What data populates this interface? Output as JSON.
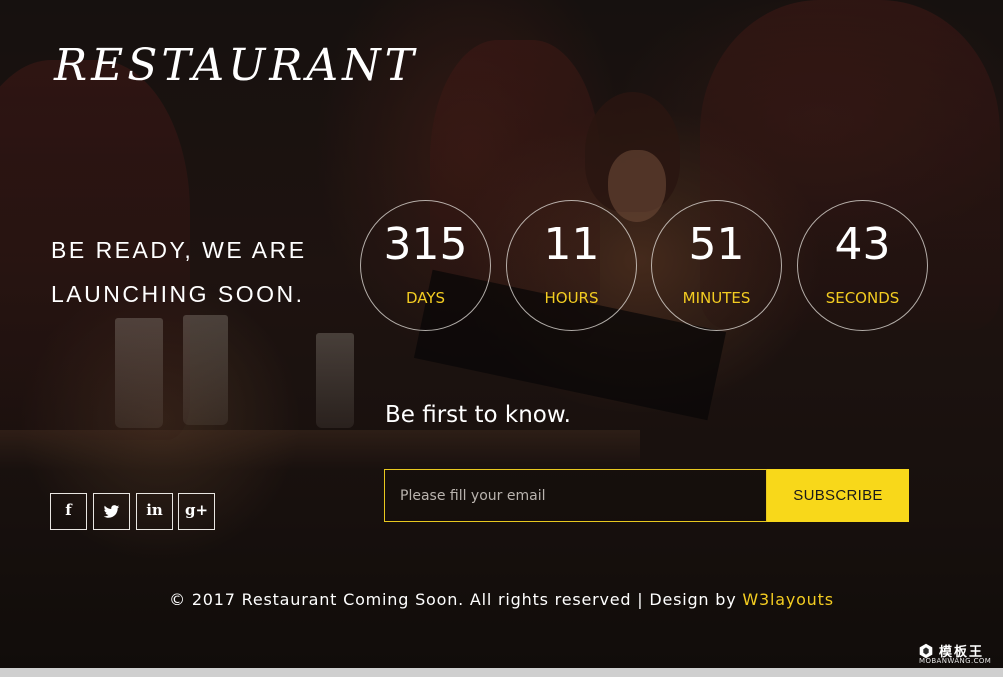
{
  "brand": {
    "logo_text": "RESTAURANT"
  },
  "tagline": {
    "line1": "BE READY, WE ARE",
    "line2": "LAUNCHING SOON."
  },
  "countdown": [
    {
      "value": "315",
      "unit": "DAYS"
    },
    {
      "value": "11",
      "unit": "HOURS"
    },
    {
      "value": "51",
      "unit": "MINUTES"
    },
    {
      "value": "43",
      "unit": "SECONDS"
    }
  ],
  "subscribe": {
    "title": "Be first to know.",
    "email_placeholder": "Please fill your email",
    "email_value": "",
    "button_label": "SUBSCRIBE"
  },
  "social": [
    {
      "name": "facebook",
      "icon": "facebook-icon",
      "glyph": "f"
    },
    {
      "name": "twitter",
      "icon": "twitter-icon",
      "glyph": ""
    },
    {
      "name": "linkedin",
      "icon": "linkedin-icon",
      "glyph": "in"
    },
    {
      "name": "google-plus",
      "icon": "google-plus-icon",
      "glyph": "g+"
    }
  ],
  "footer": {
    "text": "© 2017 Restaurant Coming Soon. All rights reserved | Design by ",
    "link_text": "W3layouts"
  },
  "watermark": {
    "cn": "模板王",
    "en": "MOBANWANG.COM"
  },
  "colors": {
    "accent": "#f8d81a",
    "unit_label": "#f3cc21",
    "text": "#ffffff"
  }
}
